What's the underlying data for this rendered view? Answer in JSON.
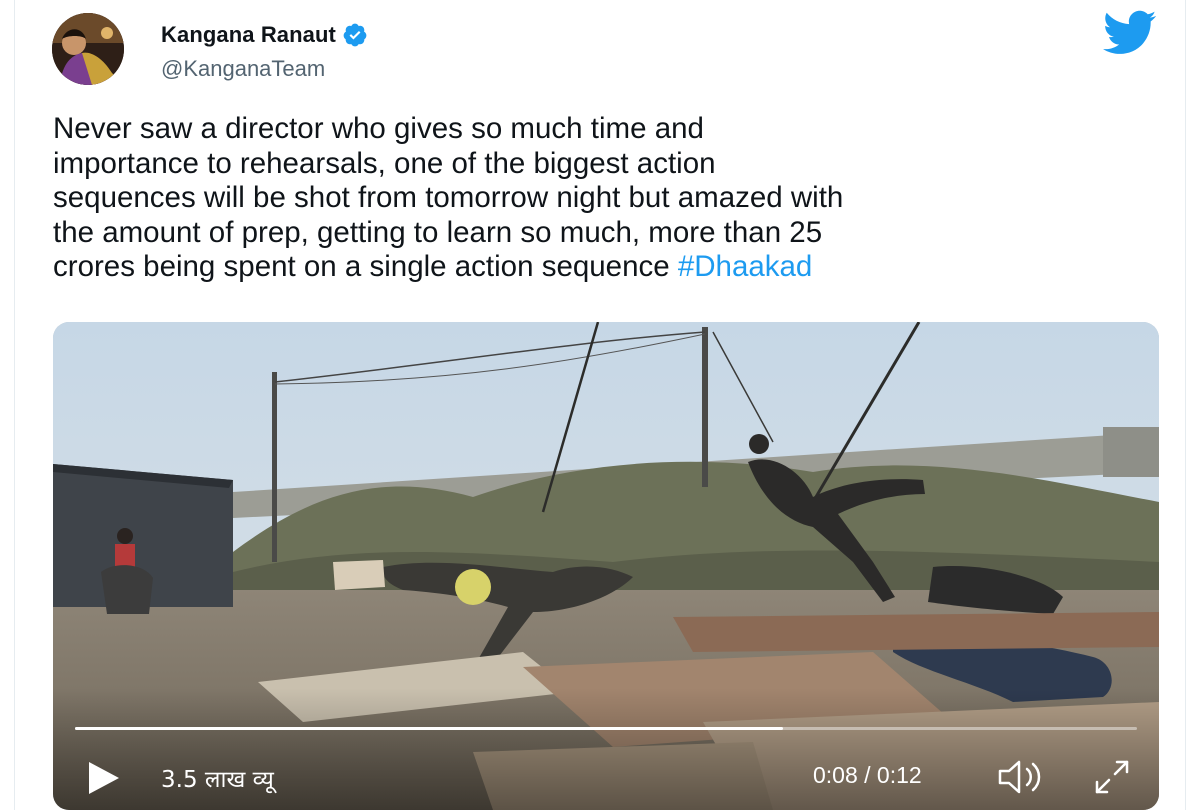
{
  "author": {
    "display_name": "Kangana Ranaut",
    "handle": "@KanganaTeam",
    "verified": true
  },
  "tweet": {
    "text": "Never saw a director who gives so much time and\nimportance to rehearsals, one of the biggest action\nsequences will be shot from tomorrow night but amazed with\nthe amount of prep, getting to learn so much, more than 25\ncrores being spent on a single action sequence ",
    "hashtag": "#Dhaakad"
  },
  "video": {
    "views": "3.5 लाख व्यू",
    "time": "0:08 / 0:12",
    "progress_fraction": 0.6667
  },
  "colors": {
    "twitter_blue": "#1d9bf0",
    "verified_blue": "#1d9bf0",
    "handle_gray": "#536471"
  },
  "icons": {
    "verified": "verified-badge-icon",
    "logo": "twitter-bird-icon",
    "play": "play-icon",
    "volume": "volume-icon",
    "fullscreen": "fullscreen-icon"
  }
}
